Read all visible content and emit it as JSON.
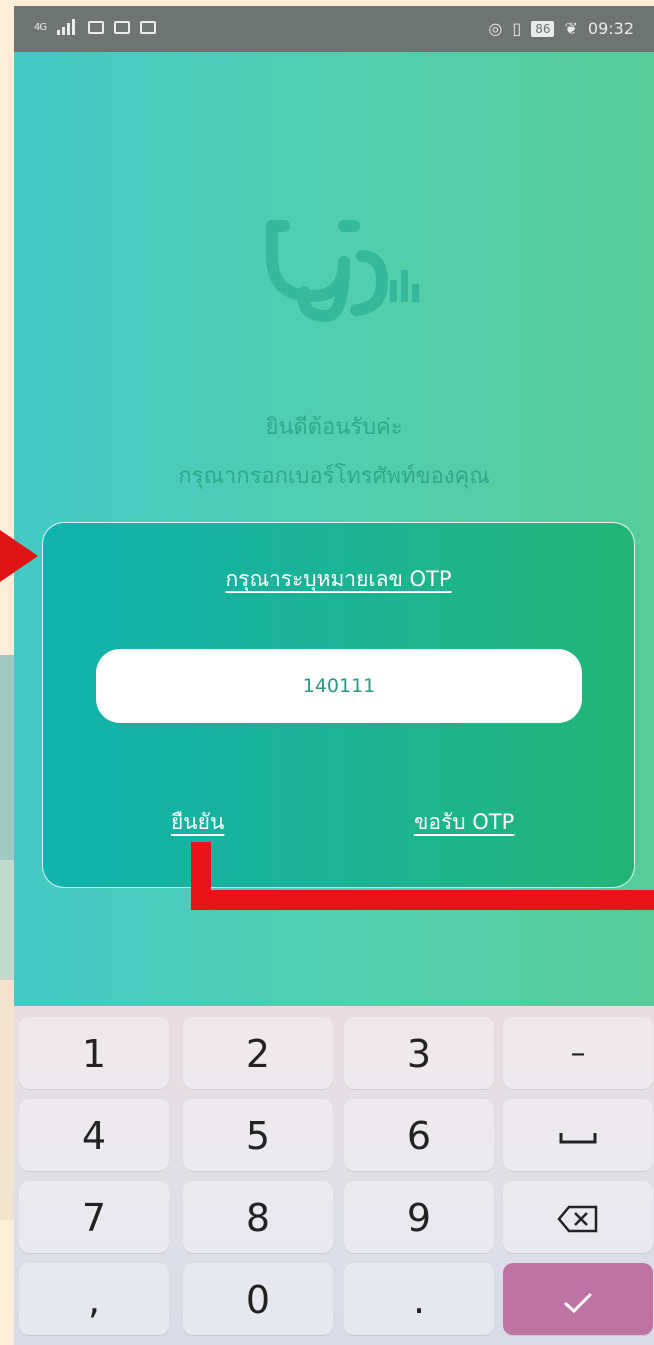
{
  "status_bar": {
    "network": "4G",
    "battery": "86",
    "time": "09:32"
  },
  "welcome": {
    "line1": "ยินดีต้อนรับค่ะ",
    "line2": "กรุณากรอกเบอร์โทรศัพท์ของคุณ"
  },
  "otp_card": {
    "title": "กรุณาระบุหมายเลข OTP",
    "otp_value": "140111",
    "confirm_label": "ยืนยัน",
    "request_label": "ขอรับ OTP"
  },
  "keypad": {
    "keys": [
      "1",
      "2",
      "3",
      "–",
      "4",
      "5",
      "6",
      "␣",
      "7",
      "8",
      "9",
      "⌫",
      ",",
      "0",
      ".",
      "✓"
    ]
  },
  "colors": {
    "background_gradient_start": "#45c9c6",
    "background_gradient_end": "#57cc9a",
    "card_gradient_start": "#11b3ad",
    "card_gradient_end": "#22b577",
    "annotation_red": "#e8141a",
    "done_key": "#be74a2"
  },
  "icons": {
    "logo": "stethoscope-icon",
    "backspace": "backspace-icon",
    "done": "checkmark-icon",
    "space": "space-bar-icon"
  }
}
